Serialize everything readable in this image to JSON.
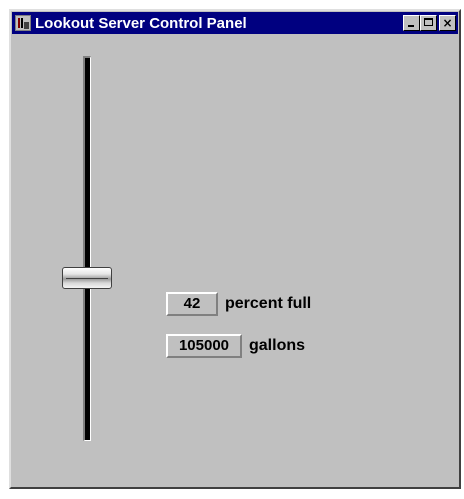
{
  "window": {
    "title": "Lookout Server Control Panel",
    "icon": "lookout-app-icon",
    "buttons": {
      "minimize": "minimize-icon",
      "maximize": "maximize-icon",
      "close": "close-icon",
      "close_glyph": "×"
    }
  },
  "tank_slider": {
    "level_percent": 42
  },
  "readouts": {
    "percent_value": "42",
    "percent_label": "percent full",
    "gallons_value": "105000",
    "gallons_label": "gallons"
  },
  "colors": {
    "titlebar": "#000080",
    "face": "#c0c0c0"
  }
}
